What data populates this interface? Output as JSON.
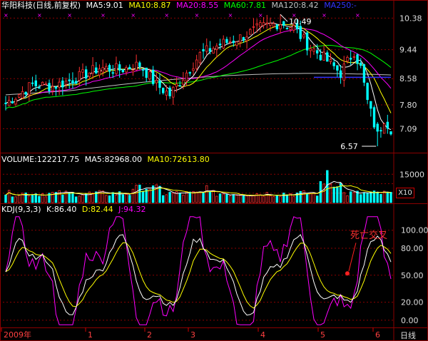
{
  "header": {
    "title": "华阳科技(日线,前复权)",
    "ma5": "MA5:9.01",
    "ma10": "MA10:8.87",
    "ma20": "MA20:8.55",
    "ma60": "MA60:7.81",
    "ma120": "MA120:8.42",
    "ma250": "MA250:-"
  },
  "volume_header": {
    "volume": "VOLUME:122217.75",
    "ma5": "MA5:82968.00",
    "ma10": "MA10:72613.80"
  },
  "kdj_header": {
    "label": "KDJ(9,3,3)",
    "k": "K:86.40",
    "d": "D:82.44",
    "j": "J:94.32"
  },
  "volume_multiplier": "X10",
  "period_label": "日线",
  "colors": {
    "up": "#ff3030",
    "down": "#00ffff",
    "ma5": "#ffffff",
    "ma10": "#ffff00",
    "ma20": "#ff00ff",
    "ma60": "#00ff00",
    "ma120": "#c0c0c0",
    "grid": "#8b0000"
  },
  "chart_data": [
    {
      "type": "candlestick",
      "panel": "price",
      "y_ticks": [
        10.38,
        9.44,
        8.58,
        7.8,
        7.09
      ],
      "ylim": [
        6.4,
        10.6
      ],
      "annotations": [
        {
          "text": "10.49",
          "value": 10.49,
          "note": "high"
        },
        {
          "text": "6.57",
          "value": 6.57,
          "note": "low"
        }
      ],
      "x_labels": [
        "2009年",
        "1",
        "2",
        "3",
        "4",
        "5",
        "6"
      ]
    },
    {
      "type": "bar",
      "panel": "volume",
      "y_ticks": [
        15000,
        10000,
        5000
      ],
      "ylim": [
        0,
        20000
      ]
    },
    {
      "type": "line",
      "panel": "kdj",
      "y_ticks": [
        100.0,
        80.0,
        50.0,
        20.0,
        0.0
      ],
      "ylim": [
        -8,
        118
      ],
      "annotations": [
        {
          "text": "死亡交叉",
          "value": 52
        }
      ]
    }
  ]
}
